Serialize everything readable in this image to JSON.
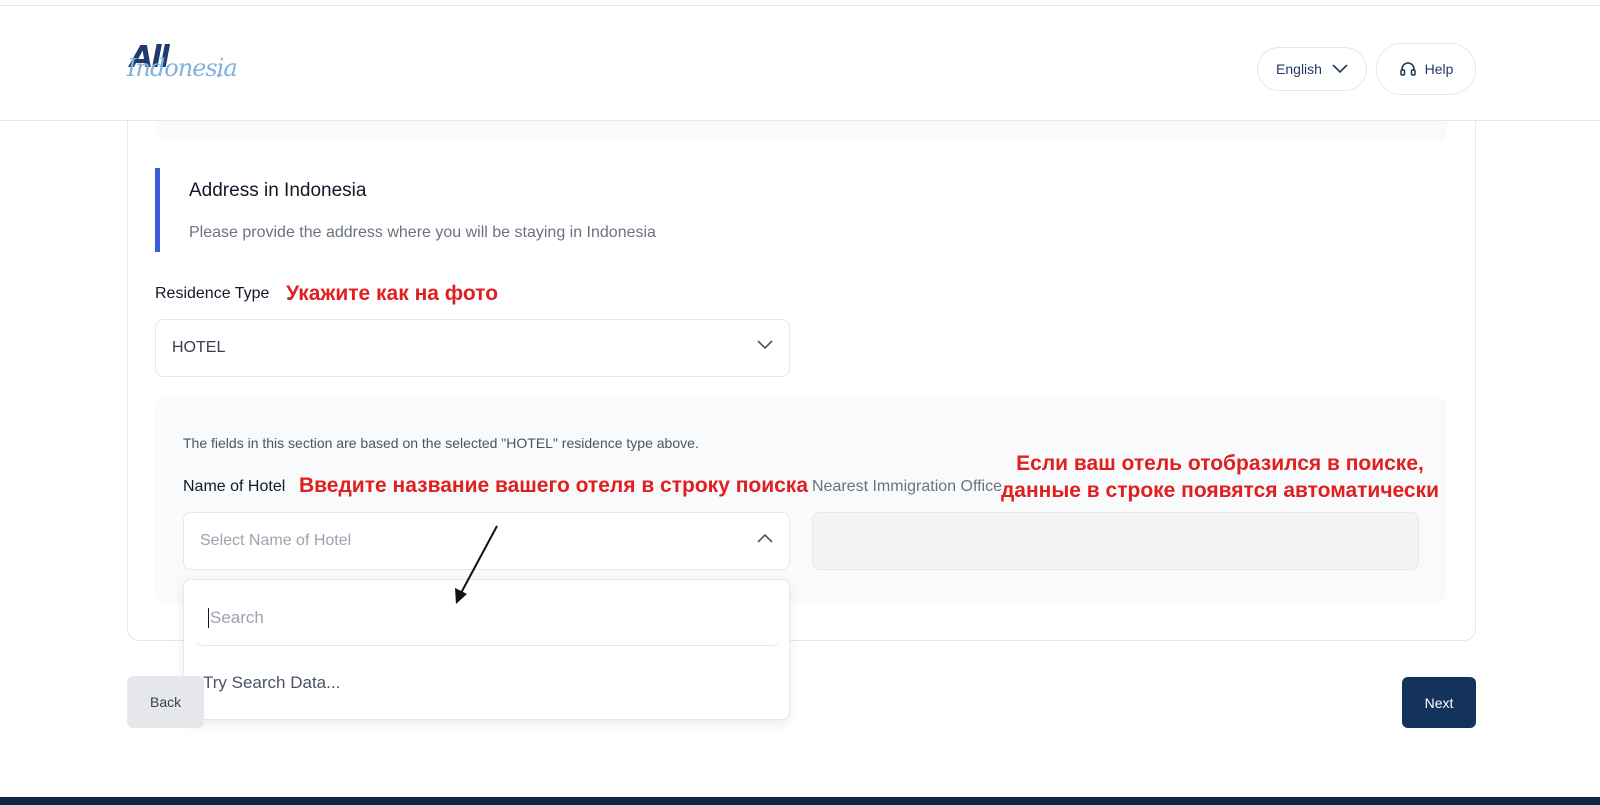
{
  "header": {
    "logo_primary": "All",
    "logo_secondary": "Indonesia",
    "language_label": "English",
    "help_label": "Help"
  },
  "section": {
    "title": "Address in Indonesia",
    "subtitle": "Please provide the address where you will be staying in Indonesia"
  },
  "residence": {
    "label": "Residence Type",
    "value": "HOTEL",
    "annotation": "Укажите как на фото"
  },
  "hotel_section": {
    "note": "The fields in this section are based on the selected \"HOTEL\" residence type above.",
    "hotel_label": "Name of Hotel",
    "hotel_placeholder": "Select Name of Hotel",
    "hotel_annotation": "Введите название вашего отеля в строку поиска",
    "immigration_label": "Nearest Immigration Office",
    "immigration_annotation_line1": "Если ваш отель отобразился в поиске,",
    "immigration_annotation_line2": "данные в строке появятся автоматически"
  },
  "dropdown": {
    "search_placeholder": "Search",
    "hint": "Try Search Data..."
  },
  "actions": {
    "back_label": "Back",
    "next_label": "Next"
  },
  "colors": {
    "accent_bar": "#3b5bdb",
    "primary_button": "#13335b",
    "annotation_red": "#e02020",
    "footer": "#0f2742"
  }
}
